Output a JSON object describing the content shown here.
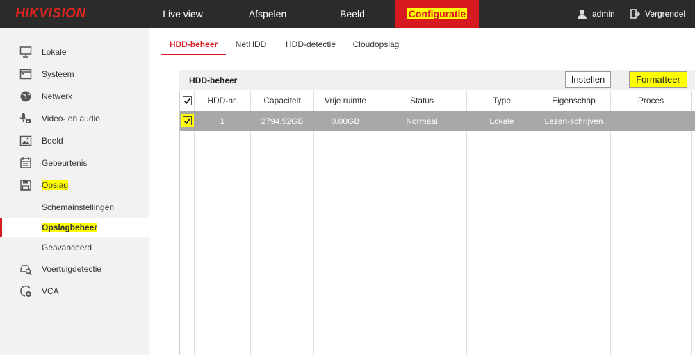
{
  "brand": "HIKVISION",
  "nav": {
    "live_view": "Live view",
    "playback": "Afspelen",
    "image": "Beeld",
    "config": "Configuratie",
    "user": "admin",
    "logout": "Vergrendel"
  },
  "sidebar": {
    "items": [
      {
        "label": "Lokale",
        "icon": "monitor-icon"
      },
      {
        "label": "Systeem",
        "icon": "window-icon"
      },
      {
        "label": "Netwerk",
        "icon": "globe-icon"
      },
      {
        "label": "Video- en audio",
        "icon": "microphone-icon"
      },
      {
        "label": "Beeld",
        "icon": "image-icon"
      },
      {
        "label": "Gebeurtenis",
        "icon": "calendar-icon"
      },
      {
        "label": "Opslag",
        "icon": "floppy-icon"
      }
    ],
    "sub_items": [
      {
        "label": "Schemainstellingen"
      },
      {
        "label": "Opslagbeheer"
      },
      {
        "label": "Geavanceerd"
      }
    ],
    "more_items": [
      {
        "label": "Voertuigdetectie",
        "icon": "vehicle-search-icon"
      },
      {
        "label": "VCA",
        "icon": "vca-icon"
      }
    ]
  },
  "tabs": [
    "HDD-beheer",
    "NetHDD",
    "HDD-detectie",
    "Cloudopslag"
  ],
  "panel": {
    "title": "HDD-beheer",
    "set_button": "Instellen",
    "format_button": "Formatteer"
  },
  "table": {
    "headers": [
      "HDD-nr.",
      "Capaciteit",
      "Vrije ruimte",
      "Status",
      "Type",
      "Eigenschap",
      "Proces"
    ],
    "rows": [
      {
        "checked": true,
        "cells": [
          "1",
          "2794.52GB",
          "0.00GB",
          "Normaal",
          "Lokale",
          "Lezen-schrijven",
          ""
        ]
      }
    ]
  },
  "colors": {
    "accent": "#d71920",
    "highlight": "#ffff00",
    "topbar": "#2b2b2b",
    "sidebar": "#f2f2f2",
    "selected_row": "#a8a8a8"
  }
}
